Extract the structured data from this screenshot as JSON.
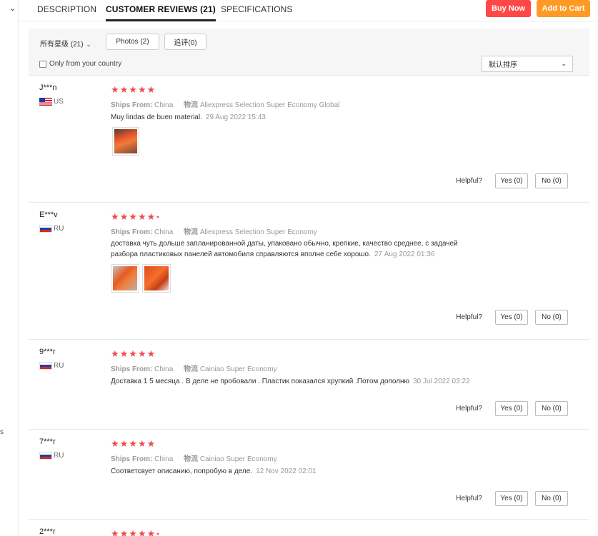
{
  "tabs": [
    {
      "label": "DESCRIPTION"
    },
    {
      "label": "CUSTOMER REVIEWS (21)"
    },
    {
      "label": "SPECIFICATIONS"
    }
  ],
  "actions": {
    "buy_now": "Buy Now",
    "add_to_cart": "Add to Cart"
  },
  "left_gutter": {
    "fragment": "s"
  },
  "filters": {
    "star_filter": "所有星级 (21)",
    "photos": "Photos (2)",
    "followup": "追评(0)",
    "only_country": "Only from your country",
    "sort": "默认排序"
  },
  "helpful_label": "Helpful?",
  "reviews": [
    {
      "user": "J***n",
      "country": "US",
      "rating": 5,
      "ships_from_label": "Ships From:",
      "ships_from": "China",
      "logistics_label": "物流",
      "logistics": "Aliexpress Selection Super Economy Global",
      "text": "Muy lindas de buen material.",
      "date": "29 Aug 2022 15:43",
      "yes": "Yes (0)",
      "no": "No (0)"
    },
    {
      "user": "E***v",
      "country": "RU",
      "rating": 4.5,
      "ships_from_label": "Ships From:",
      "ships_from": "China",
      "logistics_label": "物流",
      "logistics": "Aliexpress Selection Super Economy",
      "text_line1": "доставка чуть дольше запланированной даты, упаковано обычно, крепкие, качество среднее, с задачей",
      "text_line2": "разбора пластиковых панелей автомобиля справляются вполне себе хорошо.",
      "date": "27 Aug 2022 01:36",
      "yes": "Yes (0)",
      "no": "No (0)"
    },
    {
      "user": "9***r",
      "country": "RU",
      "rating": 5,
      "ships_from_label": "Ships From:",
      "ships_from": "China",
      "logistics_label": "物流",
      "logistics": "Cainiao Super Economy",
      "text": "Доставка 1 5 месяца . В деле не пробовали . Пластик показался хрупкий .Потом дополню",
      "date": "30 Jul 2022 03:22",
      "yes": "Yes (0)",
      "no": "No (0)"
    },
    {
      "user": "7***r",
      "country": "RU",
      "rating": 5,
      "ships_from_label": "Ships From:",
      "ships_from": "China",
      "logistics_label": "物流",
      "logistics": "Cainiao Super Economy",
      "text": "Соответсвует описанию, попробую в деле.",
      "date": "12 Nov 2022 02:01",
      "yes": "Yes (0)",
      "no": "No (0)"
    },
    {
      "user": "2***r",
      "rating": 4.5
    }
  ],
  "colors": {
    "star": "#f0494b",
    "buy_now": "#ff4747",
    "add_to_cart": "#ff9a25"
  }
}
